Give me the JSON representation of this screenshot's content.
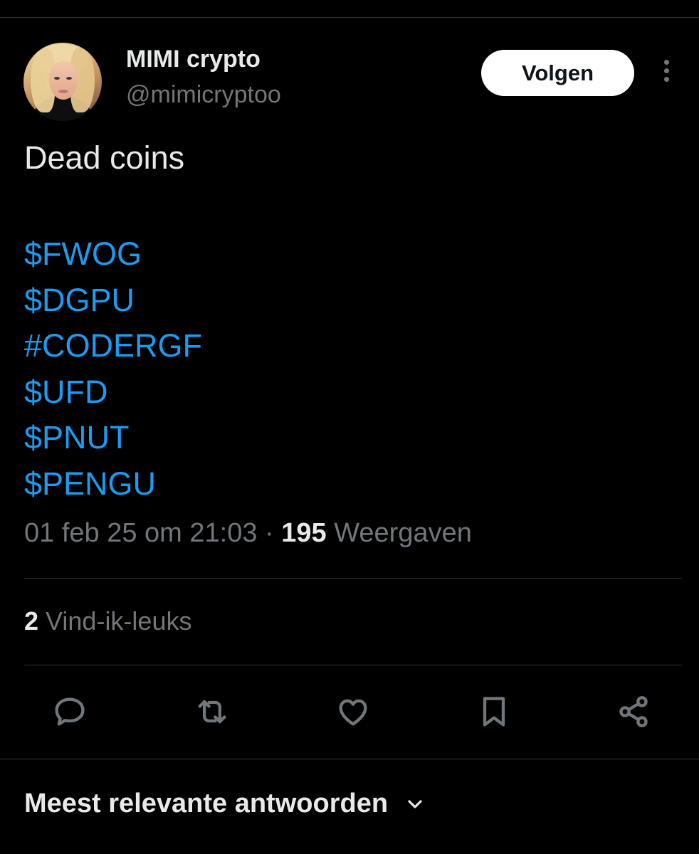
{
  "author": {
    "display_name": "MIMI crypto",
    "handle": "@mimicryptoo"
  },
  "follow_label": "Volgen",
  "tweet": {
    "text": "Dead coins",
    "tickers": [
      "$FWOG",
      "$DGPU",
      "#CODERGF",
      "$UFD",
      "$PNUT",
      "$PENGU"
    ],
    "timestamp": "01 feb 25 om 21:03",
    "separator": "·",
    "views_count": "195",
    "views_label": "Weergaven",
    "likes_count": "2",
    "likes_label": "Vind-ik-leuks"
  },
  "actions": {
    "icons": [
      "reply-icon",
      "retweet-icon",
      "like-icon",
      "bookmark-icon",
      "share-icon"
    ]
  },
  "replies_sort_label": "Meest relevante antwoorden",
  "colors": {
    "background": "#000000",
    "primary_text": "#e7e9ea",
    "secondary_text": "#71767b",
    "link": "#1d9bf0",
    "divider": "#2f3336"
  }
}
